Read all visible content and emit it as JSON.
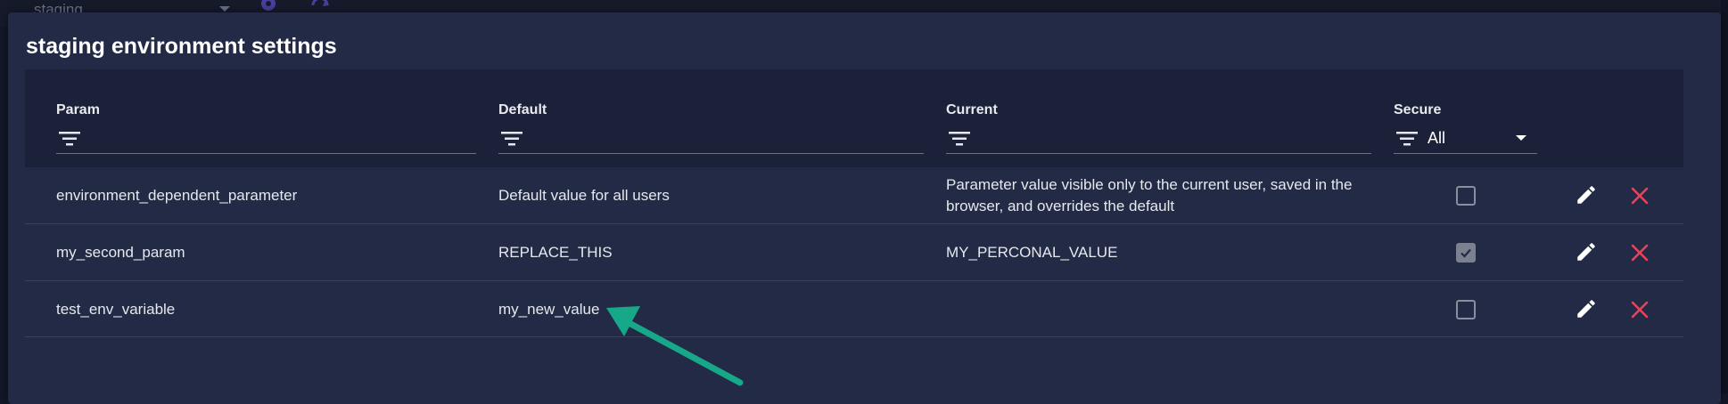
{
  "background": {
    "environment_select": "staging"
  },
  "dialog": {
    "title": "staging environment settings"
  },
  "table": {
    "columns": {
      "param": "Param",
      "default": "Default",
      "current": "Current",
      "secure": "Secure"
    },
    "filters": {
      "param": "",
      "default": "",
      "current": "",
      "secure": "All"
    },
    "rows": [
      {
        "param": "environment_dependent_parameter",
        "default": "Default value for all users",
        "current_line1": "Parameter value visible only to the current user, saved in the",
        "current_line2": "browser, and overrides the default",
        "secure": false
      },
      {
        "param": "my_second_param",
        "default": "REPLACE_THIS",
        "current": "MY_PERCONAL_VALUE",
        "secure": true
      },
      {
        "param": "test_env_variable",
        "default": "my_new_value",
        "current": "",
        "secure": false
      }
    ]
  },
  "colors": {
    "dialog_bg": "#222a45",
    "header_bg": "#1b2139",
    "delete_red": "#e8435a",
    "annotation_arrow": "#17a88a"
  },
  "icons": [
    "gear-icon",
    "refresh-icon",
    "filter-icon",
    "edit-icon",
    "close-icon",
    "dropdown-arrow-icon",
    "checkbox-icon"
  ]
}
